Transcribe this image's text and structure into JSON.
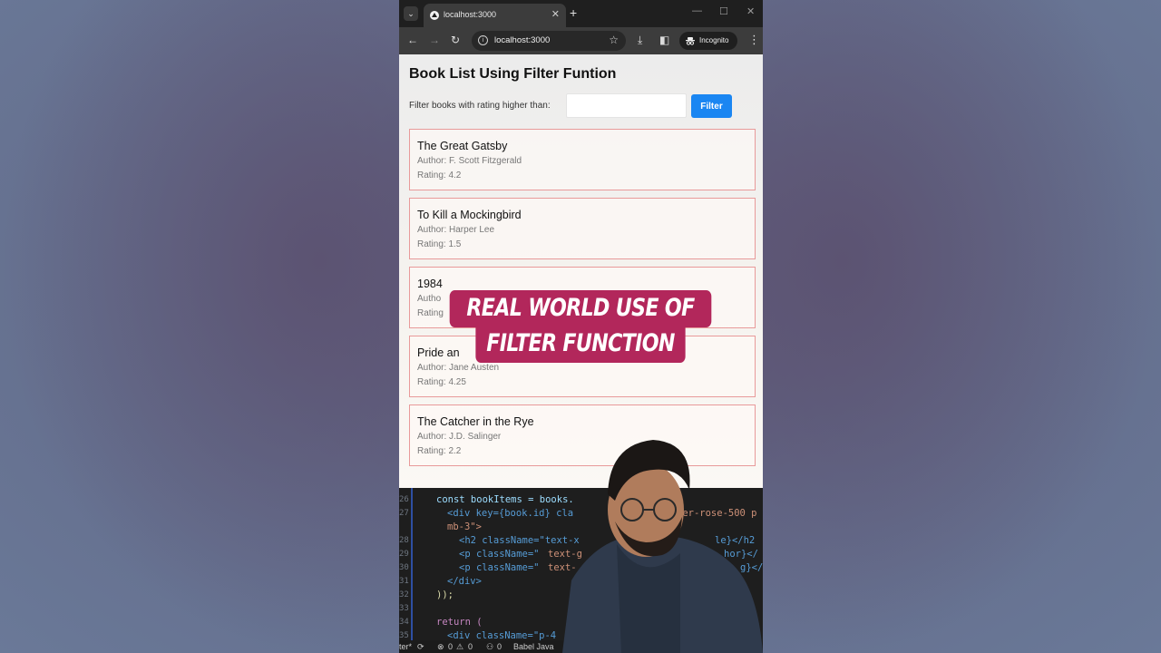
{
  "browser": {
    "tab_title": "localhost:3000",
    "url": "localhost:3000",
    "incognito_label": "Incognito",
    "icons": [
      "tab-dropdown-icon",
      "close-icon",
      "plus-icon",
      "minimize-icon",
      "maximize-icon",
      "window-close-icon",
      "back-icon",
      "forward-icon",
      "reload-icon",
      "info-icon",
      "star-icon",
      "download-icon",
      "side-panel-icon",
      "incognito-icon",
      "more-icon"
    ]
  },
  "page": {
    "title": "Book List Using Filter Funtion",
    "filter_label": "Filter books with rating higher than:",
    "filter_input_value": "",
    "filter_button": "Filter"
  },
  "books": [
    {
      "title": "The Great Gatsby",
      "author": "Author: F. Scott Fitzgerald",
      "rating": "Rating: 4.2"
    },
    {
      "title": "To Kill a Mockingbird",
      "author": "Author: Harper Lee",
      "rating": "Rating: 1.5"
    },
    {
      "title": "1984",
      "author": "Autho",
      "rating": "Rating"
    },
    {
      "title": "Pride an",
      "author": "Author: Jane Austen",
      "rating": "Rating: 4.25"
    },
    {
      "title": "The Catcher in the Rye",
      "author": "Author: J.D. Salinger",
      "rating": "Rating: 2.2"
    }
  ],
  "overlay": {
    "line1": "REAL WORLD USE OF",
    "line2": "FILTER FUNCTION"
  },
  "editor": {
    "line_numbers": [
      "26",
      "27",
      "",
      "28",
      "29",
      "30",
      "31",
      "32",
      "33",
      "34",
      "35"
    ],
    "lines": [
      "const bookItems = books.",
      "<div key={book.id} cla",
      "mb-3\">",
      "<h2 className=\"text-x",
      "<p className=\"",
      "<p className=\"",
      "</div>",
      "));",
      "",
      "return (",
      "<div className=\"p-4"
    ],
    "fragments": {
      "l27_right": "der-rose-500 p",
      "l28_right": "le}</h2",
      "l29_mid": "text-g",
      "l29_right": "hor}</",
      "l30_mid": "text-",
      "l30_right": "g}</"
    }
  },
  "statusbar": {
    "left": "ter*",
    "errors": "0",
    "warnings": "0",
    "ports": "0",
    "language": "Babel Java"
  },
  "colors": {
    "accent_button": "#1a86f2",
    "card_border": "#e89a9a",
    "banner": "#b2275b",
    "browser_dark": "#1f1f1f"
  }
}
